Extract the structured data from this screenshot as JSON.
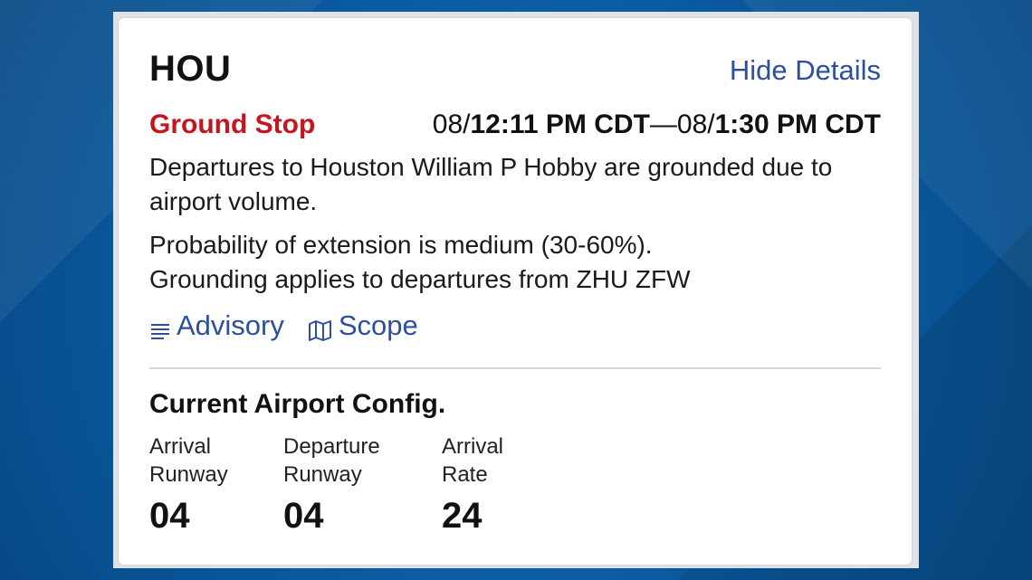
{
  "card": {
    "airport": "HOU",
    "hide_details_label": "Hide Details",
    "status": "Ground Stop",
    "time": {
      "start_prefix": "08/",
      "start_time": "12:11 PM CDT",
      "separator": "—",
      "end_prefix": "08/",
      "end_time": "1:30 PM CDT"
    },
    "description": "Departures to Houston William P Hobby are grounded due to airport volume.",
    "probability": "Probability of extension is medium (30-60%).",
    "applies": "Grounding applies to departures from ZHU ZFW",
    "links": [
      {
        "label": "Advisory",
        "icon": "list-icon"
      },
      {
        "label": "Scope",
        "icon": "map-icon"
      }
    ]
  },
  "config": {
    "title": "Current Airport Config.",
    "items": [
      {
        "label_line1": "Arrival",
        "label_line2": "Runway",
        "value": "04"
      },
      {
        "label_line1": "Departure",
        "label_line2": "Runway",
        "value": "04"
      },
      {
        "label_line1": "Arrival",
        "label_line2": "Rate",
        "value": "24"
      }
    ]
  },
  "colors": {
    "status": "#c4161c",
    "link": "#2e4f9e",
    "background": "#0a5aa0"
  }
}
